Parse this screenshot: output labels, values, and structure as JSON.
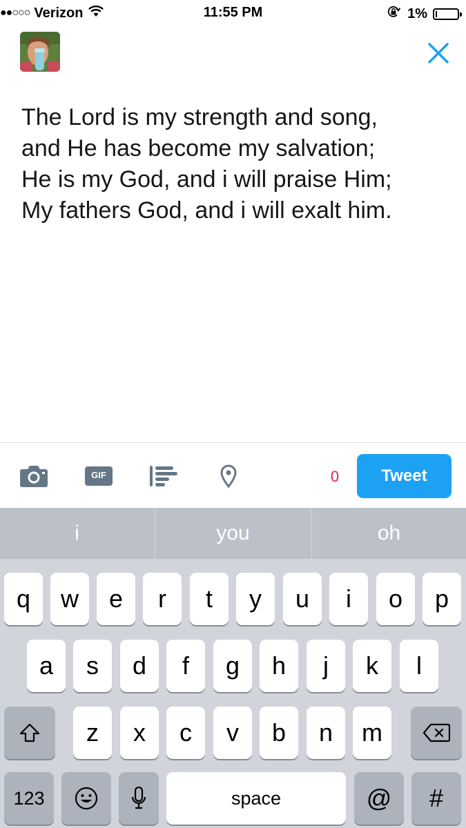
{
  "status_bar": {
    "signal": "●●○○○",
    "carrier": "Verizon",
    "time": "11:55 PM",
    "battery": "1%",
    "battery_level": 0.01
  },
  "compose": {
    "text": "The Lord is my strength and song,\nand He has become my salvation;\nHe is my God, and i will praise Him;\nMy fathers God, and i will exalt him."
  },
  "toolbar": {
    "gif_label": "GIF",
    "counter": "0",
    "tweet_label": "Tweet"
  },
  "colors": {
    "accent": "#1da1f2",
    "counter": "#e0245e"
  },
  "keyboard": {
    "suggestions": [
      "i",
      "you",
      "oh"
    ],
    "row1": [
      "q",
      "w",
      "e",
      "r",
      "t",
      "y",
      "u",
      "i",
      "o",
      "p"
    ],
    "row2": [
      "a",
      "s",
      "d",
      "f",
      "g",
      "h",
      "j",
      "k",
      "l"
    ],
    "row3": [
      "z",
      "x",
      "c",
      "v",
      "b",
      "n",
      "m"
    ],
    "numbers_label": "123",
    "space_label": "space",
    "at_label": "@",
    "hash_label": "#"
  }
}
